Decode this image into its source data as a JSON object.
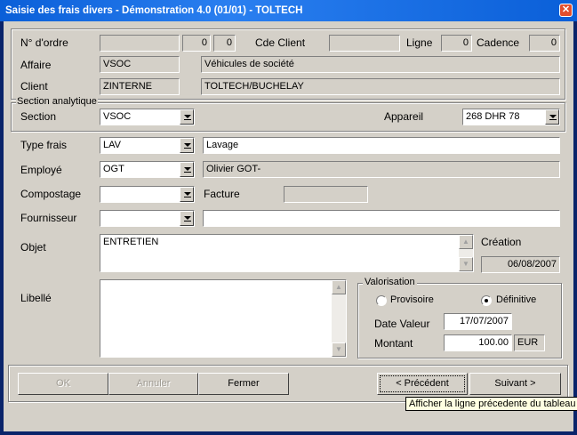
{
  "window": {
    "title": "Saisie des frais divers - Démonstration 4.0 (01/01) - TOLTECH",
    "close_glyph": "✕"
  },
  "header": {
    "ordre_label": "N° d'ordre",
    "ordre_value": "",
    "ordre_num1": "0",
    "ordre_num2": "0",
    "cde_client_label": "Cde Client",
    "cde_client_value": "",
    "ligne_label": "Ligne",
    "ligne_value": "0",
    "cadence_label": "Cadence",
    "cadence_value": "0",
    "affaire_label": "Affaire",
    "affaire_code": "VSOC",
    "affaire_desc": "Véhicules de société",
    "client_label": "Client",
    "client_code": "ZINTERNE",
    "client_desc": "TOLTECH/BUCHELAY"
  },
  "analytique": {
    "group_label": "Section analytique",
    "section_label": "Section",
    "section_value": "VSOC",
    "appareil_label": "Appareil",
    "appareil_value": "268 DHR 78"
  },
  "details": {
    "type_label": "Type frais",
    "type_code": "LAV",
    "type_desc": "Lavage",
    "employe_label": "Employé",
    "employe_code": "OGT",
    "employe_desc": "Olivier GOT-",
    "compostage_label": "Compostage",
    "compostage_value": "",
    "facture_label": "Facture",
    "facture_value": "",
    "fournisseur_label": "Fournisseur",
    "fournisseur_code": "",
    "fournisseur_desc": "",
    "objet_label": "Objet",
    "objet_value": "ENTRETIEN",
    "creation_label": "Création",
    "creation_value": "06/08/2007",
    "libelle_label": "Libellé",
    "libelle_value": ""
  },
  "valorisation": {
    "group_label": "Valorisation",
    "provisoire_label": "Provisoire",
    "definitive_label": "Définitive",
    "selected": "Définitive",
    "date_label": "Date Valeur",
    "date_value": "17/07/2007",
    "montant_label": "Montant",
    "montant_value": "100.00",
    "currency": "EUR"
  },
  "buttons": {
    "ok": "OK",
    "annuler": "Annuler",
    "fermer": "Fermer",
    "precedent": "< Précédent",
    "suivant": "Suivant >"
  },
  "tooltip": "Afficher la ligne précedente du tableau",
  "colors": {
    "title_bar": "#0a5fd8",
    "face": "#d4d0c8",
    "tooltip_bg": "#ffffe1"
  }
}
